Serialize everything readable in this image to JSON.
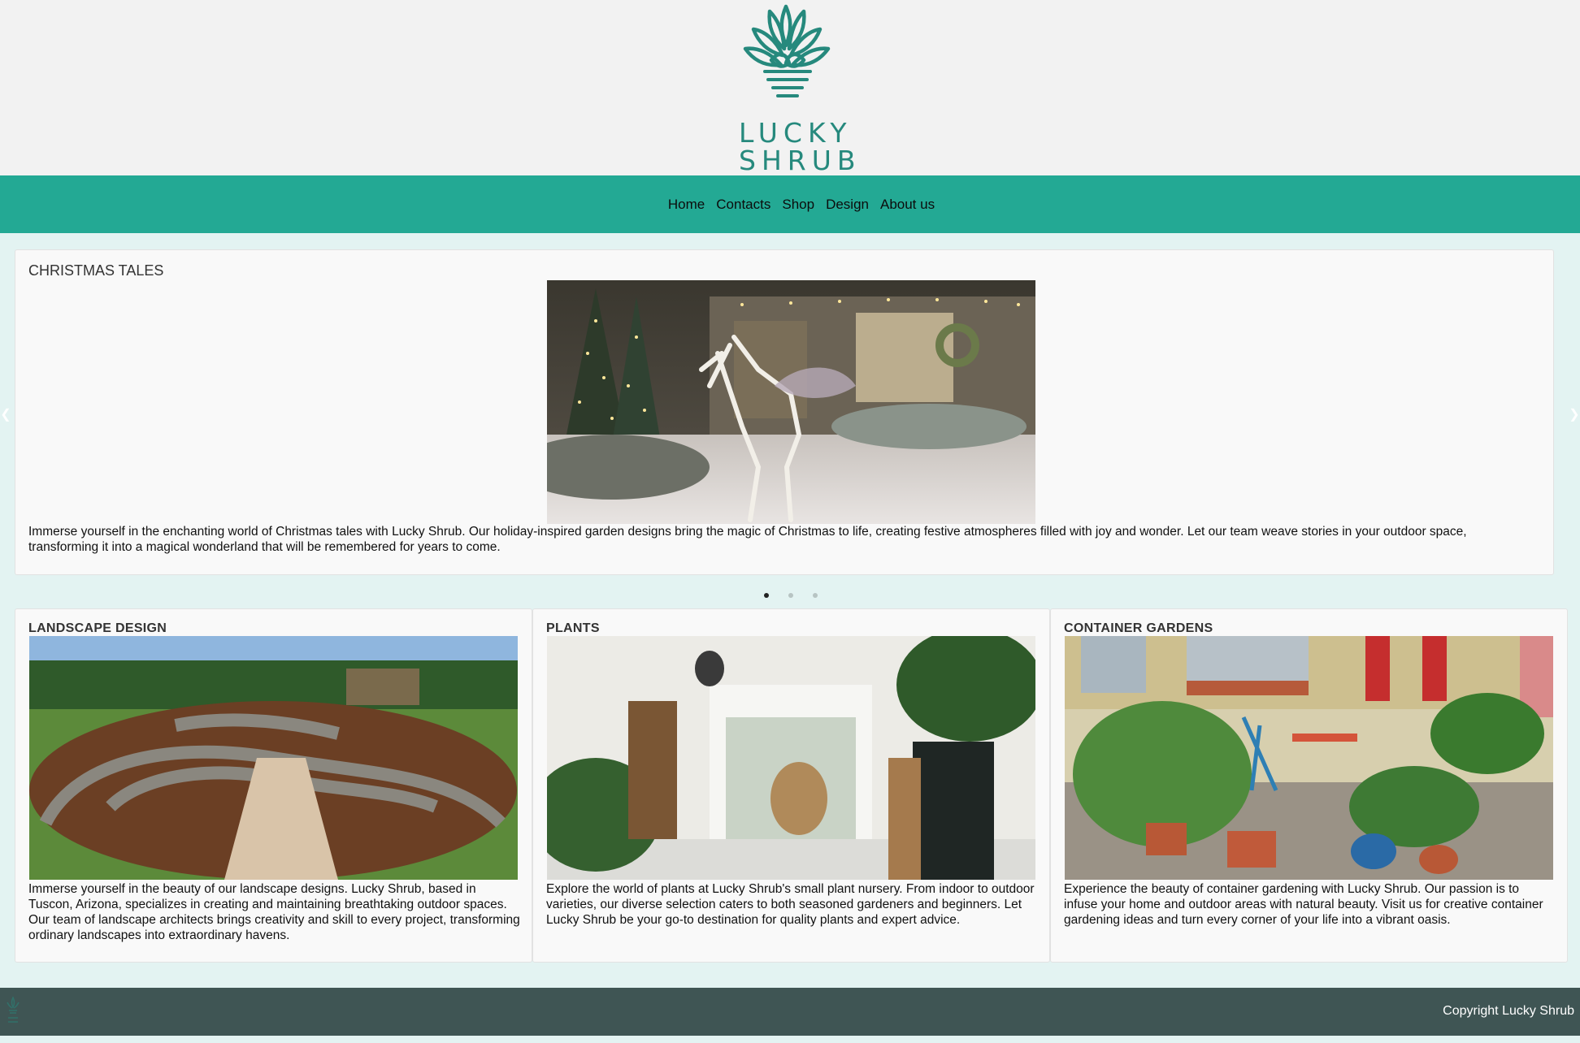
{
  "brand": {
    "name_line1": "LUCKY",
    "name_line2": "SHRUB",
    "color": "#26897d"
  },
  "nav": {
    "items": [
      {
        "label": "Home"
      },
      {
        "label": "Contacts"
      },
      {
        "label": "Shop"
      },
      {
        "label": "Design"
      },
      {
        "label": "About us"
      }
    ],
    "background": "#23a994"
  },
  "carousel": {
    "prev_icon": "chevron-left-icon",
    "next_icon": "chevron-right-icon",
    "active_slide": 1,
    "slide_count": 3,
    "slide": {
      "title": "CHRISTMAS TALES",
      "image": "illuminated-unicorn-christmas-lights-house",
      "text": "Immerse yourself in the enchanting world of Christmas tales with Lucky Shrub. Our holiday-inspired garden designs bring the magic of Christmas to life, creating festive atmospheres filled with joy and wonder. Let our team weave stories in your outdoor space, transforming it into a magical wonderland that will be remembered for years to come."
    }
  },
  "cards": [
    {
      "title": "LANDSCAPE DESIGN",
      "image": "curved-raised-garden-beds",
      "text": "Immerse yourself in the beauty of our landscape designs. Lucky Shrub, based in Tuscon, Arizona, specializes in creating and maintaining breathtaking outdoor spaces. Our team of landscape architects brings creativity and skill to every project, transforming ordinary landscapes into extraordinary havens."
    },
    {
      "title": "PLANTS",
      "image": "indoor-plant-room",
      "text": "Explore the world of plants at Lucky Shrub's small plant nursery. From indoor to outdoor varieties, our diverse selection caters to both seasoned gardeners and beginners. Let Lucky Shrub be your go-to destination for quality plants and expert advice."
    },
    {
      "title": "CONTAINER GARDENS",
      "image": "potted-plants-courtyard",
      "text": "Experience the beauty of container gardening with Lucky Shrub. Our passion is to infuse your home and outdoor areas with natural beauty. Visit us for creative container gardening ideas and turn every corner of your life into a vibrant oasis."
    }
  ],
  "footer": {
    "copyright": "Copyright Lucky Shrub",
    "background": "#3f5554"
  }
}
